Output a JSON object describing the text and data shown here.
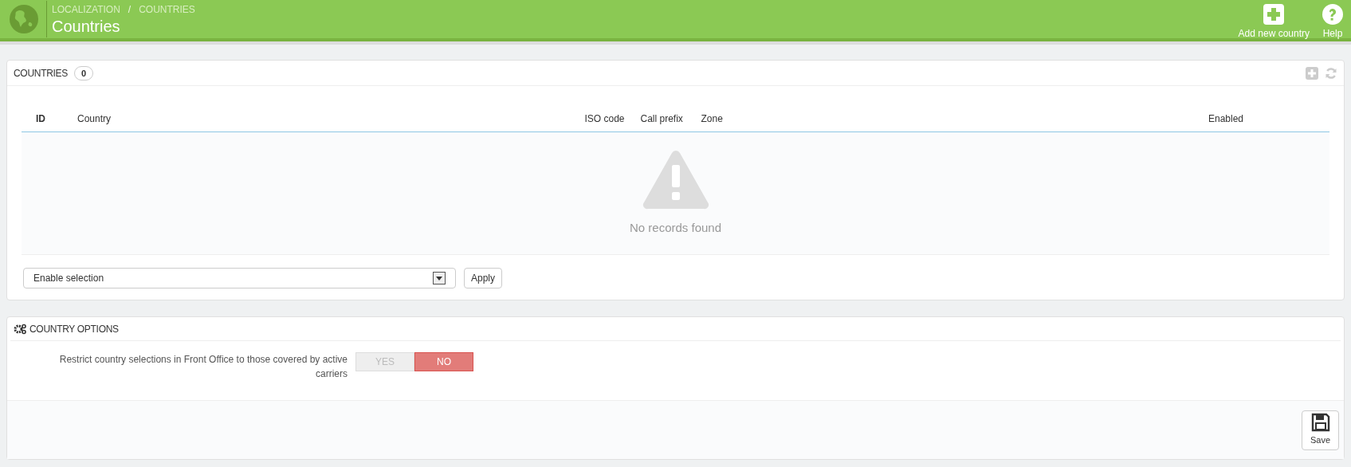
{
  "header": {
    "breadcrumb": [
      "LOCALIZATION",
      "COUNTRIES"
    ],
    "breadcrumb_separator": "/",
    "title": "Countries",
    "toolbar": [
      {
        "kind": "add",
        "label": "Add new country"
      },
      {
        "kind": "help",
        "label": "Help"
      }
    ]
  },
  "countries_panel": {
    "title": "COUNTRIES",
    "count": "0",
    "table": {
      "columns": [
        {
          "label": "ID",
          "kind": "id"
        },
        {
          "label": "Country",
          "kind": "wide"
        },
        {
          "label": "ISO code",
          "kind": "iso"
        },
        {
          "label": "Call prefix",
          "kind": "prefix"
        },
        {
          "label": "Zone",
          "kind": "wide2"
        },
        {
          "label": "Enabled",
          "kind": "end"
        }
      ],
      "empty_message": "No records found"
    },
    "bulk_action": {
      "value": "Enable selection"
    },
    "apply_button": "Apply"
  },
  "options_panel": {
    "title": "COUNTRY OPTIONS",
    "field_label": "Restrict country selections in Front Office to those covered by active carriers",
    "toggle": [
      {
        "label": "YES",
        "selected": false
      },
      {
        "label": "NO",
        "selected": true
      }
    ],
    "save_button": "Save"
  }
}
